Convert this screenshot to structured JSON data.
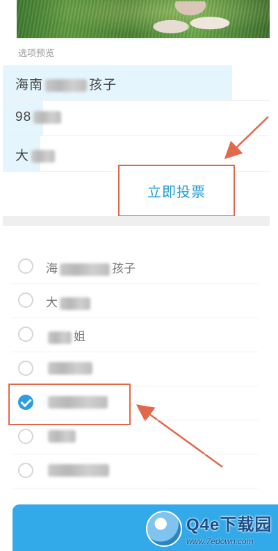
{
  "section_label": "选项预览",
  "preview_options": [
    {
      "prefix": "海南",
      "suffix": "孩子",
      "vote_fraction": 0.86
    },
    {
      "prefix": "98",
      "suffix": "",
      "vote_fraction": 0.15
    },
    {
      "prefix": "大",
      "suffix": "",
      "vote_fraction": 0.14
    }
  ],
  "vote_button_label": "立即投票",
  "vote_options": [
    {
      "prefix": "海",
      "suffix": "孩子",
      "checked": false
    },
    {
      "prefix": "大",
      "suffix": "",
      "checked": false
    },
    {
      "prefix": "",
      "suffix": "姐",
      "checked": false
    },
    {
      "prefix": "",
      "suffix": "",
      "checked": false
    },
    {
      "prefix": "",
      "suffix": "",
      "checked": true
    },
    {
      "prefix": "",
      "suffix": "",
      "checked": false
    },
    {
      "prefix": "",
      "suffix": "",
      "checked": false
    }
  ],
  "watermark": {
    "title": "Q4e下载园",
    "url": "www.7edown.com"
  },
  "colors": {
    "accent": "#1e9ad6",
    "annotation": "#e2684c",
    "checked": "#2b9ee3",
    "preview_fill": "#e5f5fd"
  }
}
